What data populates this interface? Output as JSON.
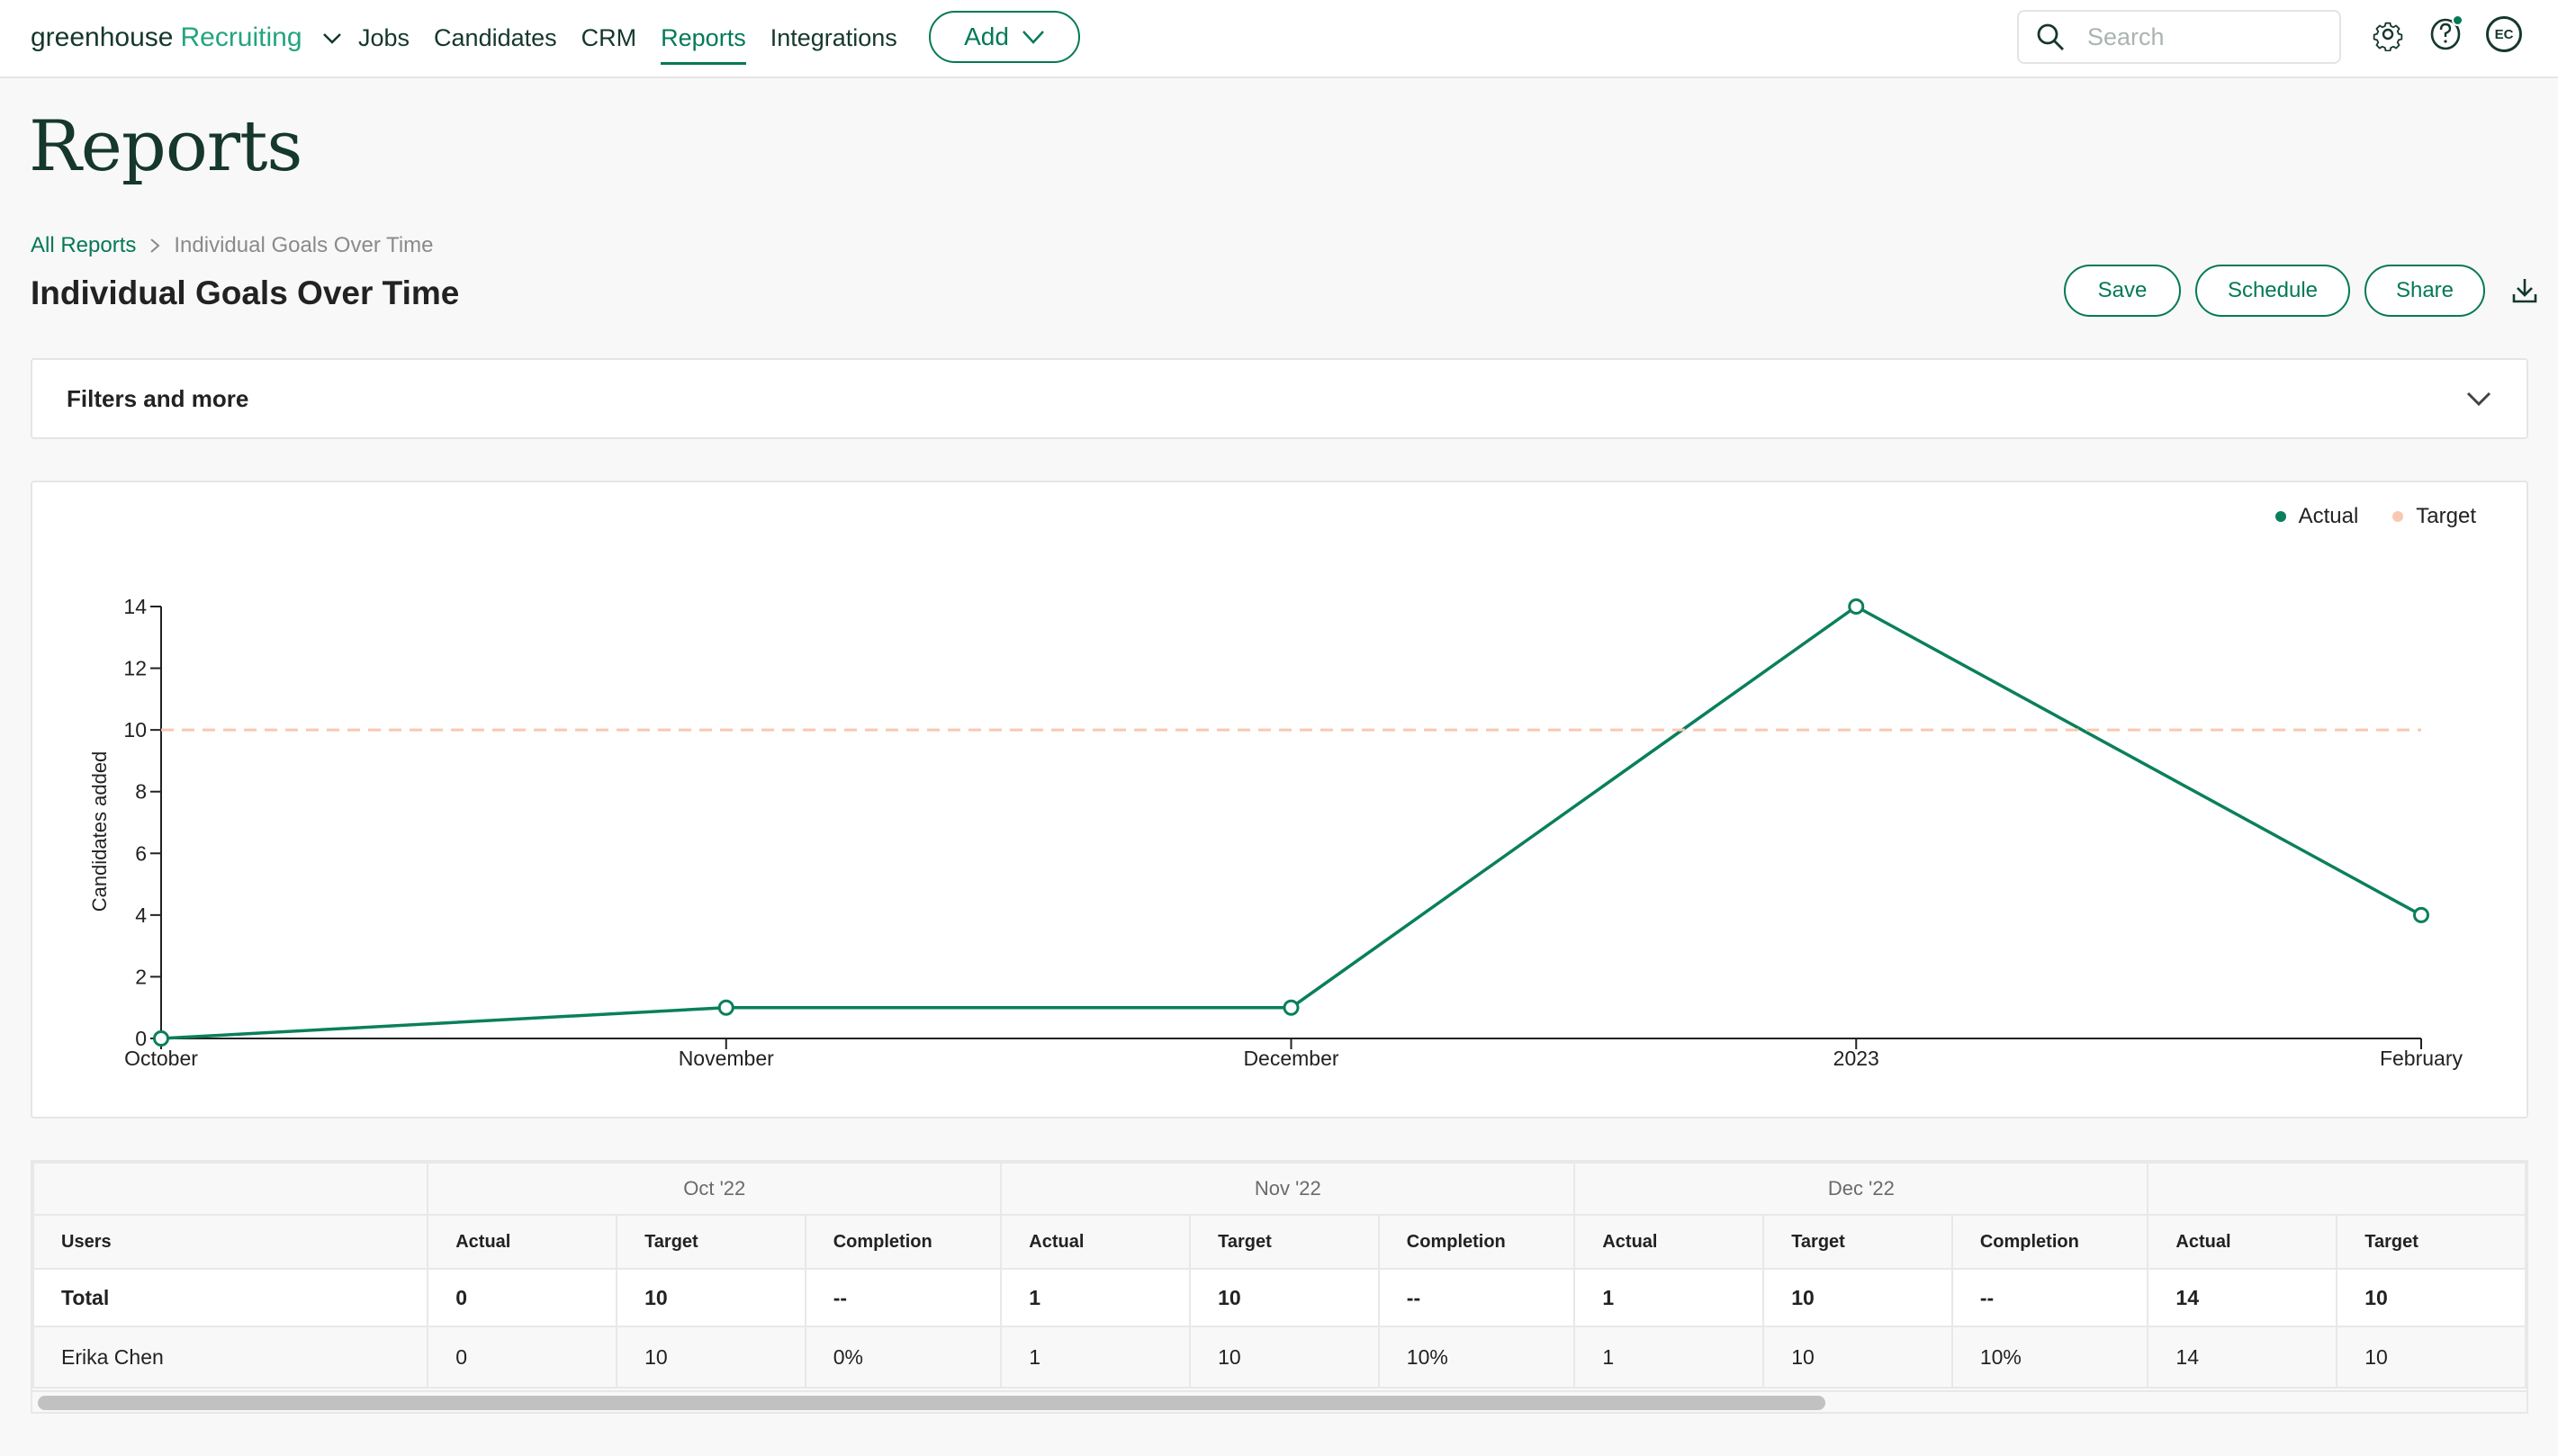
{
  "nav": {
    "logo_primary": "greenhouse",
    "logo_secondary": "Recruiting",
    "links": [
      {
        "label": "Jobs",
        "active": false
      },
      {
        "label": "Candidates",
        "active": false
      },
      {
        "label": "CRM",
        "active": false
      },
      {
        "label": "Reports",
        "active": true
      },
      {
        "label": "Integrations",
        "active": false
      }
    ],
    "add_label": "Add",
    "search_placeholder": "Search",
    "icons": [
      "settings-gear-icon",
      "help-icon",
      "avatar"
    ],
    "avatar_initials": "EC",
    "help_notification": true
  },
  "header": {
    "page_title": "Reports",
    "breadcrumb": {
      "root": "All Reports",
      "current": "Individual Goals Over Time"
    },
    "report_title": "Individual Goals Over Time",
    "actions": {
      "save": "Save",
      "schedule": "Schedule",
      "share": "Share",
      "download_icon": "download-icon"
    }
  },
  "filters": {
    "label": "Filters and more",
    "expanded": false
  },
  "colors": {
    "brand": "#047957",
    "actual": "#0a7f5c",
    "target": "#f8c8b0",
    "dark": "#15372c"
  },
  "chart_data": {
    "type": "line",
    "title": "",
    "xlabel": "",
    "ylabel": "Candidates added",
    "categories": [
      "October",
      "November",
      "December",
      "2023",
      "February"
    ],
    "series": [
      {
        "name": "Actual",
        "values": [
          0,
          1,
          1,
          14,
          4
        ],
        "style": "solid",
        "color": "#0a7f5c"
      },
      {
        "name": "Target",
        "values": [
          10,
          10,
          10,
          10,
          10
        ],
        "style": "dashed",
        "color": "#f8c8b0"
      }
    ],
    "ylim": [
      0,
      14
    ],
    "yticks": [
      0,
      2,
      4,
      6,
      8,
      10,
      12,
      14
    ],
    "grid": false,
    "legend": {
      "placement": "top-right",
      "entries": [
        "Actual",
        "Target"
      ]
    }
  },
  "table": {
    "groups": [
      "Oct '22",
      "Nov '22",
      "Dec '22",
      ""
    ],
    "user_header": "Users",
    "subheaders": [
      "Actual",
      "Target",
      "Completion"
    ],
    "rows": [
      {
        "name": "Total",
        "bold": true,
        "cells": [
          "0",
          "10",
          "--",
          "1",
          "10",
          "--",
          "1",
          "10",
          "--",
          "14",
          "10"
        ]
      },
      {
        "name": "Erika Chen",
        "bold": false,
        "cells": [
          "0",
          "10",
          "0%",
          "1",
          "10",
          "10%",
          "1",
          "10",
          "10%",
          "14",
          "10"
        ]
      }
    ],
    "scroll_position_fraction": 0
  }
}
